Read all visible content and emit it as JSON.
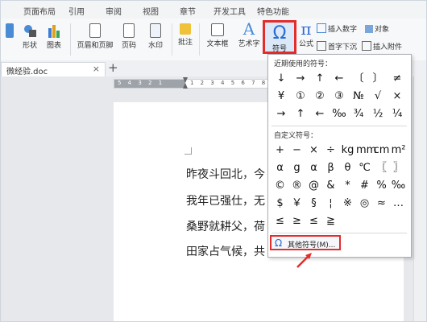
{
  "menu": {
    "tabs": [
      "页面布局",
      "引用",
      "审阅",
      "视图",
      "章节",
      "开发工具",
      "特色功能"
    ]
  },
  "ribbon": {
    "shapes_label": "形状",
    "chart_label": "图表",
    "header_footer_label": "页眉和页脚",
    "page_number_label": "页码",
    "watermark_label": "水印",
    "comment_label": "批注",
    "textbox_label": "文本框",
    "wordart_label": "艺术字",
    "symbol_label": "符号",
    "formula_label": "公式",
    "insert_number_label": "插入数字",
    "object_label": "对象",
    "first_letter_label": "首字下沉",
    "insert_attachment_label": "插入附件"
  },
  "doc_tabs": {
    "file_name": "微经验.doc",
    "close_glyph": "×",
    "add_glyph": "+"
  },
  "ruler": {
    "left_numbers": "5 4 3 2 1",
    "right_numbers": "1 2 3 4 5 6 7 8 9"
  },
  "document": {
    "lines": [
      "昨夜斗回北，今",
      "我年已强仕，无",
      "桑野就耕父，荷",
      "田家占气候，共"
    ]
  },
  "symbol_panel": {
    "recent_title": "近期使用的符号：",
    "recent_symbols": [
      "↓",
      "→",
      "↑",
      "←",
      "〔",
      "〕",
      "≠",
      "¥",
      "①",
      "②",
      "③",
      "№",
      "√",
      "×",
      "→",
      "↑",
      "←",
      "‰",
      "¾",
      "½",
      "¼"
    ],
    "custom_title": "自定义符号：",
    "custom_symbols": [
      "+",
      "−",
      "×",
      "÷",
      "kg",
      "mm",
      "cm",
      "m²",
      "α",
      "g",
      "α",
      "β",
      "θ",
      "℃",
      "〖",
      "〗",
      "©",
      "®",
      "@",
      "&",
      "*",
      "#",
      "%",
      "‰",
      "$",
      "￥",
      "§",
      "¦",
      "※",
      "◎",
      "≈",
      "…",
      "≤",
      "≥",
      "≤",
      "≧"
    ],
    "more_label": "其他符号(M)..."
  },
  "colors": {
    "highlight_red": "#e32d2d",
    "accent_blue": "#2a6bd2"
  }
}
